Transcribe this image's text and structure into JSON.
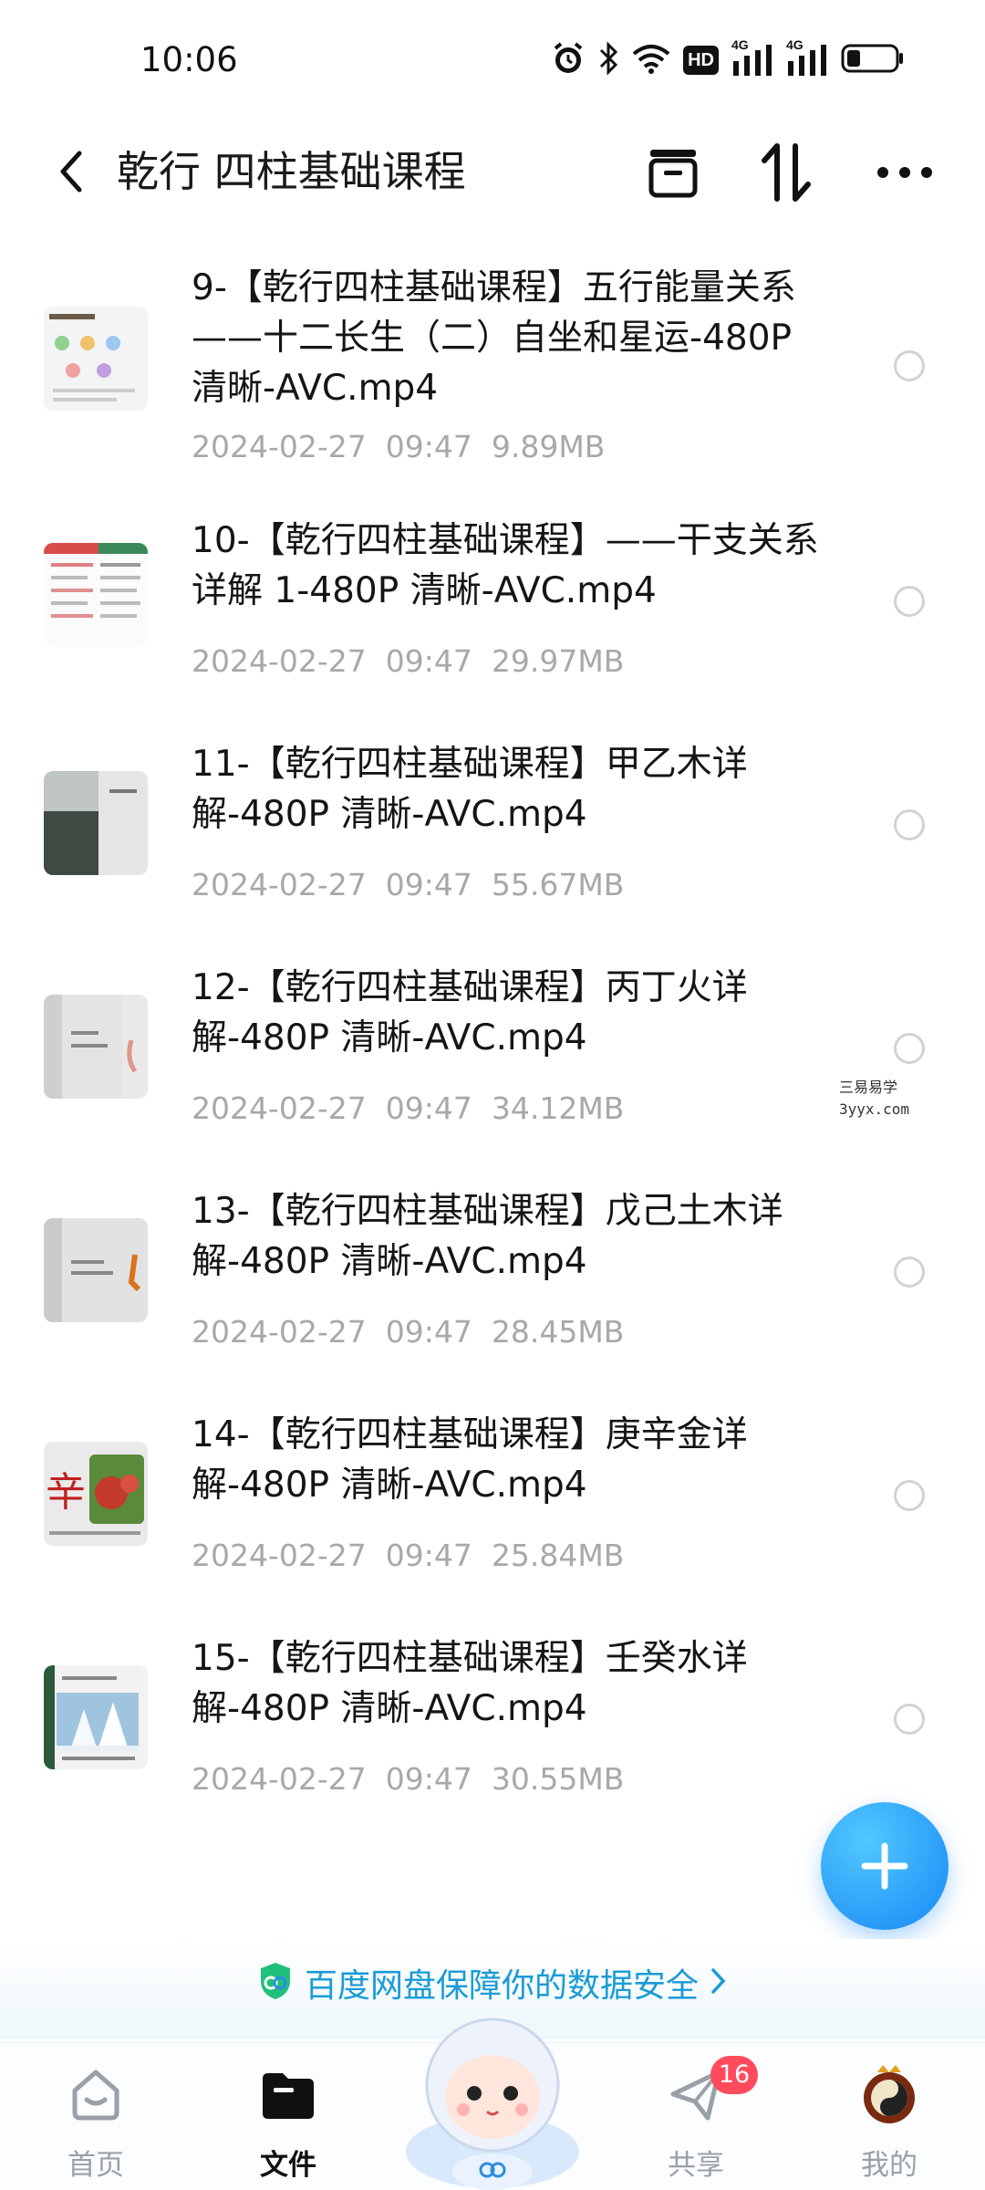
{
  "status_bar": {
    "time": "10:06",
    "icons": [
      "alarm-icon",
      "bluetooth-icon",
      "wifi-icon",
      "hd-icon",
      "signal-4g-icon",
      "signal-4g-icon",
      "battery-icon"
    ],
    "hd_label": "HD",
    "net_label": "4G"
  },
  "header": {
    "title": "乾行 四柱基础课程",
    "icons": [
      "back-icon",
      "archive-icon",
      "sort-icon",
      "more-icon"
    ]
  },
  "files": [
    {
      "name": "9-【乾行四柱基础课程】五行能量关系——十二长生（二）自坐和星运-480P 清晰-AVC.mp4",
      "date": "2024-02-27",
      "time": "09:47",
      "size": "9.89MB"
    },
    {
      "name": "10-【乾行四柱基础课程】——干支关系详解 1-480P 清晰-AVC.mp4",
      "date": "2024-02-27",
      "time": "09:47",
      "size": "29.97MB"
    },
    {
      "name": "11-【乾行四柱基础课程】甲乙木详解-480P 清晰-AVC.mp4",
      "date": "2024-02-27",
      "time": "09:47",
      "size": "55.67MB"
    },
    {
      "name": "12-【乾行四柱基础课程】丙丁火详解-480P 清晰-AVC.mp4",
      "date": "2024-02-27",
      "time": "09:47",
      "size": "34.12MB"
    },
    {
      "name": "13-【乾行四柱基础课程】戊己土木详解-480P 清晰-AVC.mp4",
      "date": "2024-02-27",
      "time": "09:47",
      "size": "28.45MB"
    },
    {
      "name": "14-【乾行四柱基础课程】庚辛金详解-480P 清晰-AVC.mp4",
      "date": "2024-02-27",
      "time": "09:47",
      "size": "25.84MB"
    },
    {
      "name": "15-【乾行四柱基础课程】壬癸水详解-480P 清晰-AVC.mp4",
      "date": "2024-02-27",
      "time": "09:47",
      "size": "30.55MB"
    }
  ],
  "watermark": {
    "line1": "三易易学",
    "line2": "3yyx.com"
  },
  "banner": {
    "text": "百度网盘保障你的数据安全",
    "icon": "shield-icon"
  },
  "tabs": [
    {
      "label": "首页",
      "icon": "home-icon",
      "active": false
    },
    {
      "label": "文件",
      "icon": "folder-icon",
      "active": true
    },
    {
      "label": "共享",
      "icon": "paper-plane-icon",
      "active": false,
      "badge": "16"
    },
    {
      "label": "我的",
      "icon": "avatar-icon",
      "active": false
    }
  ],
  "colors": {
    "accent": "#1a9bd6",
    "fab": "#1788f5",
    "badge": "#ff4b5c"
  }
}
